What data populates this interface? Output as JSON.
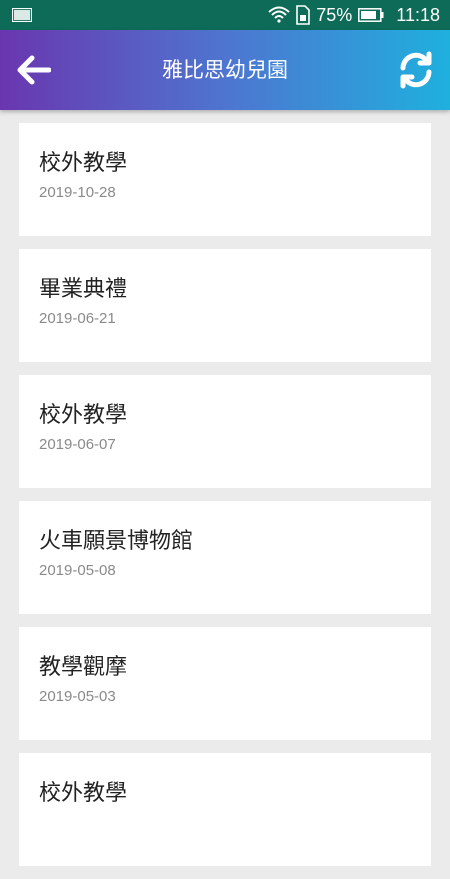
{
  "status_bar": {
    "battery_percent": "75%",
    "time": "11:18",
    "icons": [
      "gallery-icon",
      "wifi-icon",
      "sim-icon",
      "battery-icon"
    ]
  },
  "app_bar": {
    "title": "雅比思幼兒園",
    "back_icon": "arrow-left-icon",
    "refresh_icon": "refresh-icon",
    "gradient_colors": [
      "#6a36b0",
      "#4e75d0",
      "#1fb0de"
    ]
  },
  "items": [
    {
      "title": "校外教學",
      "date": "2019-10-28"
    },
    {
      "title": "畢業典禮",
      "date": "2019-06-21"
    },
    {
      "title": "校外教學",
      "date": "2019-06-07"
    },
    {
      "title": "火車願景博物館",
      "date": "2019-05-08"
    },
    {
      "title": "教學觀摩",
      "date": "2019-05-03"
    },
    {
      "title": "校外教學",
      "date": ""
    }
  ]
}
